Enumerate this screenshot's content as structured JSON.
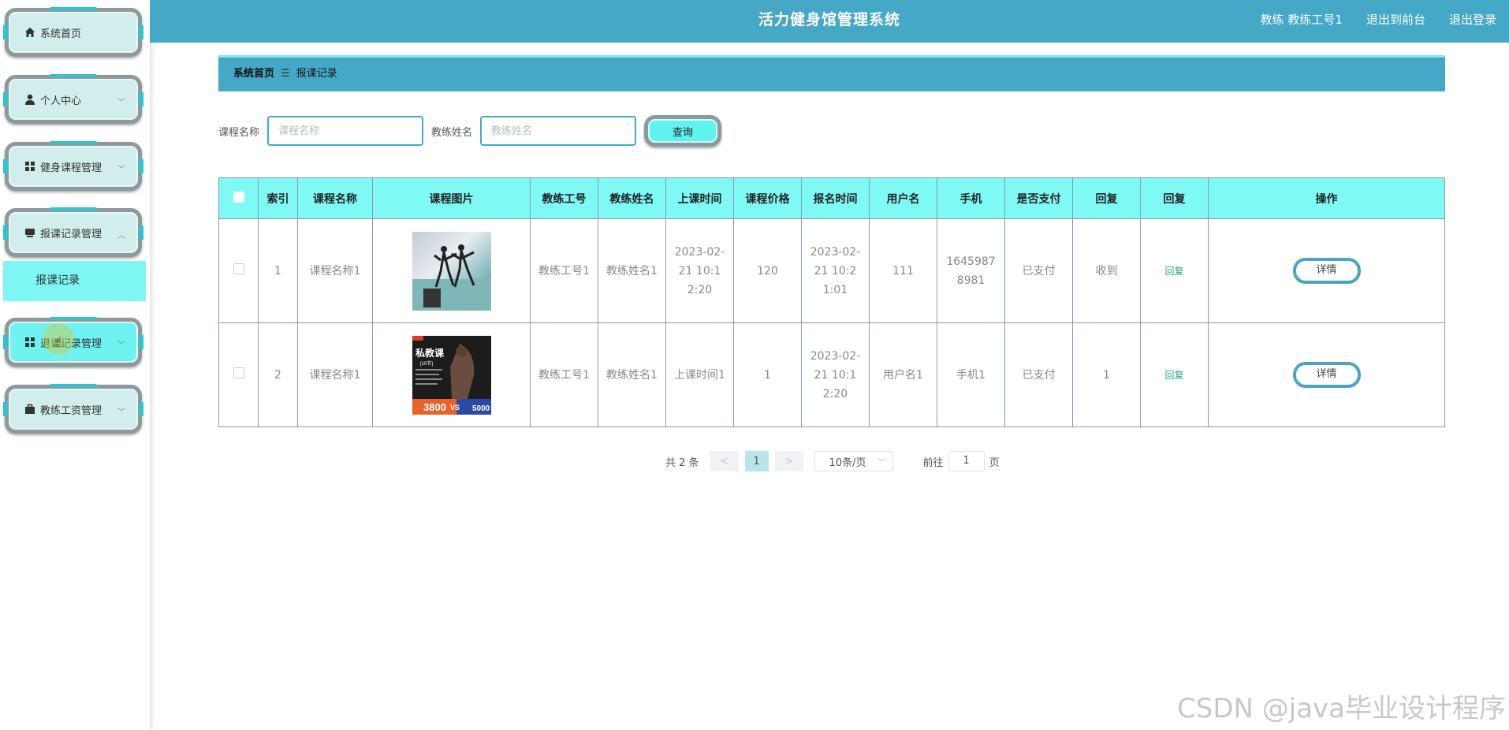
{
  "header": {
    "title": "活力健身馆管理系统",
    "user_label": "教练 教练工号1",
    "front_label": "退出到前台",
    "logout_label": "退出登录"
  },
  "sidebar": {
    "items": [
      {
        "label": "系统首页",
        "icon": "home-icon"
      },
      {
        "label": "个人中心",
        "icon": "user-icon"
      },
      {
        "label": "健身课程管理",
        "icon": "grid-icon"
      },
      {
        "label": "报课记录管理",
        "icon": "inbox-icon"
      },
      {
        "label": "退课记录管理",
        "icon": "grid-icon"
      },
      {
        "label": "教练工资管理",
        "icon": "briefcase-icon"
      }
    ],
    "submenu": "报课记录"
  },
  "breadcrumb": {
    "home": "系统首页",
    "separator": "☰",
    "current": "报课记录"
  },
  "search": {
    "course_label": "课程名称",
    "course_placeholder": "课程名称",
    "coach_label": "教练姓名",
    "coach_placeholder": "教练姓名",
    "query_label": "查询"
  },
  "table": {
    "headers": [
      "索引",
      "课程名称",
      "课程图片",
      "教练工号",
      "教练姓名",
      "上课时间",
      "课程价格",
      "报名时间",
      "用户名",
      "手机",
      "是否支付",
      "回复",
      "回复",
      "操作"
    ],
    "rows": [
      {
        "index": "1",
        "course": "课程名称1",
        "coach_no": "教练工号1",
        "coach_name": "教练姓名1",
        "class_time": "2023-02-21 10:12:20",
        "price": "120",
        "signup_time": "2023-02-21 10:21:01",
        "username": "111",
        "phone": "16459878981",
        "paid": "已支付",
        "reply": "收到",
        "reply_link": "回复",
        "action": "详情"
      },
      {
        "index": "2",
        "course": "课程名称1",
        "coach_no": "教练工号1",
        "coach_name": "教练姓名1",
        "class_time": "上课时间1",
        "price": "1",
        "signup_time": "2023-02-21 10:12:20",
        "username": "用户名1",
        "phone": "手机1",
        "paid": "已支付",
        "reply": "1",
        "reply_link": "回复",
        "action": "详情"
      }
    ],
    "images": {
      "img2_title": "私教课",
      "img2_sub": "[10节]",
      "img2_price1": "3800",
      "img2_vs": "VS",
      "img2_price2": "5000"
    }
  },
  "pagination": {
    "total": "共 2 条",
    "prev": "<",
    "current": "1",
    "next": ">",
    "page_size": "10条/页",
    "goto_label": "前往",
    "goto_value": "1",
    "page_suffix": "页"
  },
  "watermark": "CSDN @java毕业设计程序"
}
